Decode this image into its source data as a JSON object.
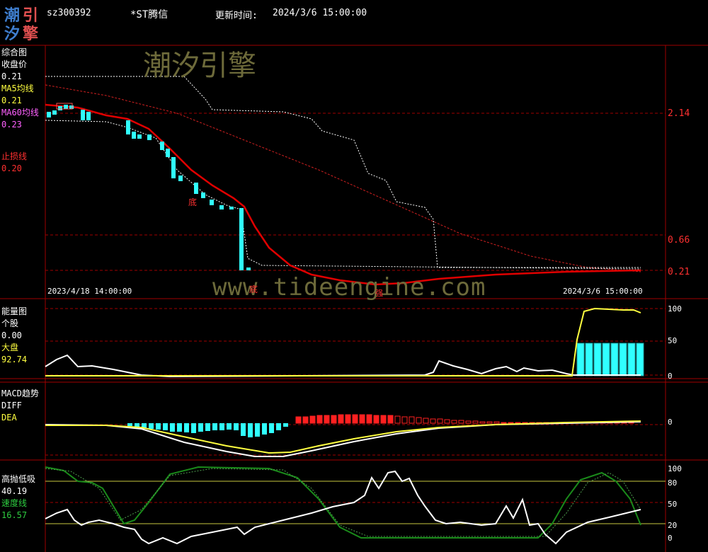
{
  "header": {
    "logo_chars": [
      "潮",
      "引",
      "汐",
      "擎"
    ],
    "code": "sz300392",
    "name": "*ST腾信",
    "update_label": "更新时间:",
    "update_time": "2024/3/6 15:00:00"
  },
  "panel_main": {
    "title": "综合图",
    "close_label": "收盘价",
    "close_value": "0.21",
    "ma5_label": "MA5均线",
    "ma5_value": "0.21",
    "ma60_label": "MA60均线",
    "ma60_value": "0.23",
    "stop_label": "止损线",
    "stop_value": "0.20",
    "axis": [
      "2.14",
      "0.66",
      "0.21"
    ],
    "start_date": "2023/4/18 14:00:00",
    "end_date": "2024/3/6 15:00:00",
    "marks": [
      "底",
      "底",
      "强"
    ]
  },
  "panel_energy": {
    "title": "能量图",
    "stock_label": "个股",
    "stock_value": "0.00",
    "market_label": "大盘",
    "market_value": "92.74",
    "axis": [
      "100",
      "50",
      "0"
    ]
  },
  "panel_macd": {
    "title": "MACD趋势",
    "diff_label": "DIFF",
    "dea_label": "DEA",
    "axis": [
      "0"
    ]
  },
  "panel_hl": {
    "title": "高抛低吸",
    "value": "40.19",
    "speed_label": "速度线",
    "speed_value": "16.57",
    "axis": [
      "100",
      "80",
      "50",
      "20",
      "0"
    ]
  },
  "watermark": {
    "cn": "潮汐引擎",
    "url": "www.tideengine.com"
  },
  "colors": {
    "grid": "#a00000",
    "ma60": "#e00000",
    "cyan": "#30ffff",
    "yellow": "#ffff40",
    "green": "#1a8a1a"
  }
}
